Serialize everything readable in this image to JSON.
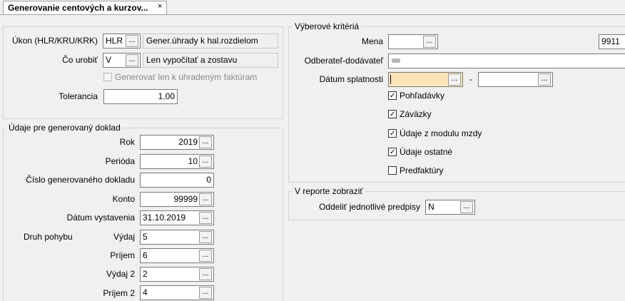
{
  "tab": {
    "title": "Generovanie centových a kurzov...",
    "close": "×"
  },
  "top_group": {
    "ukon": {
      "label": "Úkon (HLR/KRU/KRK)",
      "value": "HLR",
      "desc": "Gener.úhrady k hal.rozdielom"
    },
    "co_urobit": {
      "label": "Čo urobiť",
      "value": "V",
      "desc": "Len vypočítať a zostavu"
    },
    "generovat": {
      "label": "Generovať len k uhradeným faktúram",
      "checked": false,
      "enabled": false
    },
    "tolerancia": {
      "label": "Tolerancia",
      "value": "1,00"
    }
  },
  "doklad_group": {
    "title": "Údaje pre generovaný doklad",
    "rok": {
      "label": "Rok",
      "value": "2019"
    },
    "perioda": {
      "label": "Perióda",
      "value": "10"
    },
    "cislo": {
      "label": "Číslo generovaného dokladu",
      "value": "0"
    },
    "konto": {
      "label": "Konto",
      "value": "99999"
    },
    "datum": {
      "label": "Dátum vystavenia",
      "value": "31.10.2019"
    },
    "druh_pohybu": {
      "label": "Druh pohybu"
    },
    "vydaj": {
      "label": "Výdaj",
      "value": "5"
    },
    "prijem": {
      "label": "Príjem",
      "value": "6"
    },
    "vydaj2": {
      "label": "Výdaj 2",
      "value": "2"
    },
    "prijem2": {
      "label": "Príjem 2",
      "value": "4"
    }
  },
  "kriteria_group": {
    "title": "Výberové kritériá",
    "mena": {
      "label": "Mena",
      "value": "",
      "right_value": "9911"
    },
    "odberatel": {
      "label": "Odberateľ-dodávateľ",
      "value": ""
    },
    "datum_splatnosti": {
      "label": "Dátum splatnosti",
      "from": "",
      "dash": "-",
      "to": ""
    },
    "checks": [
      {
        "label": "Pohľadávky",
        "checked": true
      },
      {
        "label": "Záväzky",
        "checked": true
      },
      {
        "label": "Údaje z modulu mzdy",
        "checked": true
      },
      {
        "label": "Údaje ostatné",
        "checked": true
      },
      {
        "label": "Predfaktúry",
        "checked": false
      }
    ]
  },
  "report_group": {
    "title": "V reporte zobraziť",
    "oddelit": {
      "label": "Oddeliť jednotlivé predpisy",
      "value": "N"
    }
  },
  "ellipsis": "...",
  "check_mark": "✓"
}
